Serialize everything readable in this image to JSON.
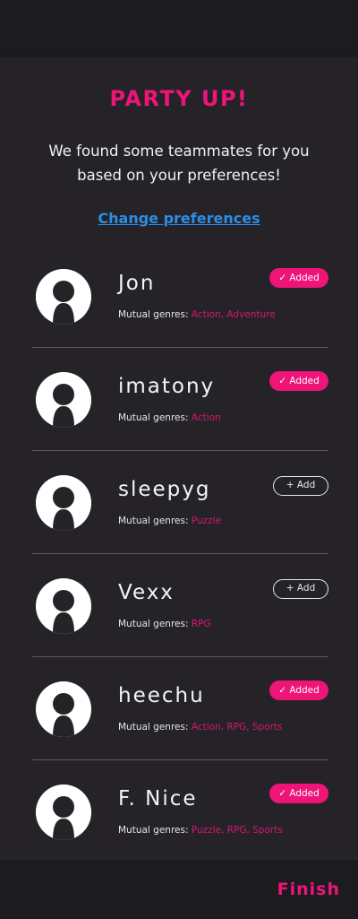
{
  "header": {
    "title": "PARTY UP!",
    "subtitle": "We found some teammates for you based on your preferences!",
    "change_link": "Change preferences"
  },
  "genres_label": "Mutual genres: ",
  "teammates": [
    {
      "name": "Jon",
      "genres": "Action, Adventure",
      "status": "✓ Added",
      "added": true
    },
    {
      "name": "imatony",
      "genres": "Action",
      "status": "✓ Added",
      "added": true
    },
    {
      "name": "sleepyg",
      "genres": "Puzzle",
      "status": "+ Add",
      "added": false
    },
    {
      "name": "Vexx",
      "genres": "RPG",
      "status": "+ Add",
      "added": false
    },
    {
      "name": "heechu",
      "genres": "Action, RPG, Sports",
      "status": "✓ Added",
      "added": true
    },
    {
      "name": "F. Nice",
      "genres": "Puzzle, RPG, Sports",
      "status": "✓ Added",
      "added": true
    }
  ],
  "footer": {
    "finish_label": "Finish"
  },
  "colors": {
    "accent": "#ee1478",
    "link": "#2b8ee6",
    "background": "#252328"
  }
}
